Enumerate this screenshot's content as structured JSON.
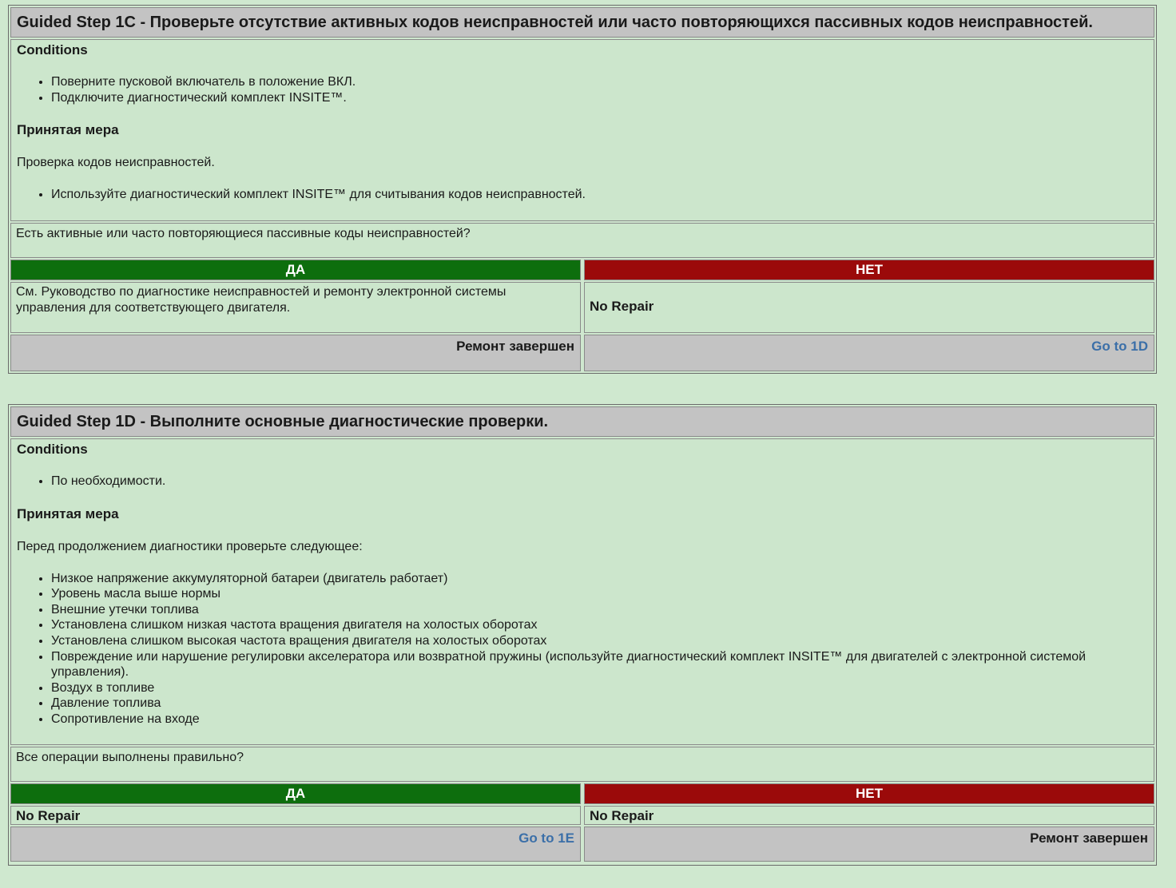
{
  "step1c": {
    "title": "Guided Step 1C - Проверьте отсутствие активных кодов неисправностей или часто повторяющихся пассивных кодов неисправностей.",
    "conditions_label": "Conditions",
    "conditions": [
      "Поверните пусковой включатель в положение ВКЛ.",
      "Подключите диагностический комплект INSITE™."
    ],
    "action_label": "Принятая мера",
    "action_text": "Проверка кодов неисправностей.",
    "action_items": [
      "Используйте диагностический комплект INSITE™ для считывания кодов неисправностей."
    ],
    "question": "Есть активные или часто повторяющиеся пассивные коды неисправностей?",
    "yes_label": "ДА",
    "no_label": "НЕТ",
    "yes_result": "См. Руководство по диагностике неисправностей и ремонту электронной системы управления для соответствующего двигателя.",
    "no_result": "No Repair",
    "yes_action": "Ремонт завершен",
    "no_action": "Go to 1D"
  },
  "step1d": {
    "title": "Guided Step 1D - Выполните основные диагностические проверки.",
    "conditions_label": "Conditions",
    "conditions": [
      "По необходимости."
    ],
    "action_label": "Принятая мера",
    "action_text": "Перед продолжением диагностики проверьте следующее:",
    "action_items": [
      "Низкое напряжение аккумуляторной батареи (двигатель работает)",
      "Уровень масла выше нормы",
      "Внешние утечки топлива",
      "Установлена слишком низкая частота вращения двигателя на холостых оборотах",
      "Установлена слишком высокая частота вращения двигателя на холостых оборотах",
      "Повреждение или нарушение регулировки акселератора или возвратной пружины (используйте диагностический комплект INSITE™ для двигателей с электронной системой управления).",
      "Воздух в топливе",
      "Давление топлива",
      "Сопротивление на входе"
    ],
    "question": "Все операции выполнены правильно?",
    "yes_label": "ДА",
    "no_label": "НЕТ",
    "yes_result": "No Repair",
    "no_result": "No Repair",
    "yes_action": "Go to 1E",
    "no_action": "Ремонт завершен"
  }
}
